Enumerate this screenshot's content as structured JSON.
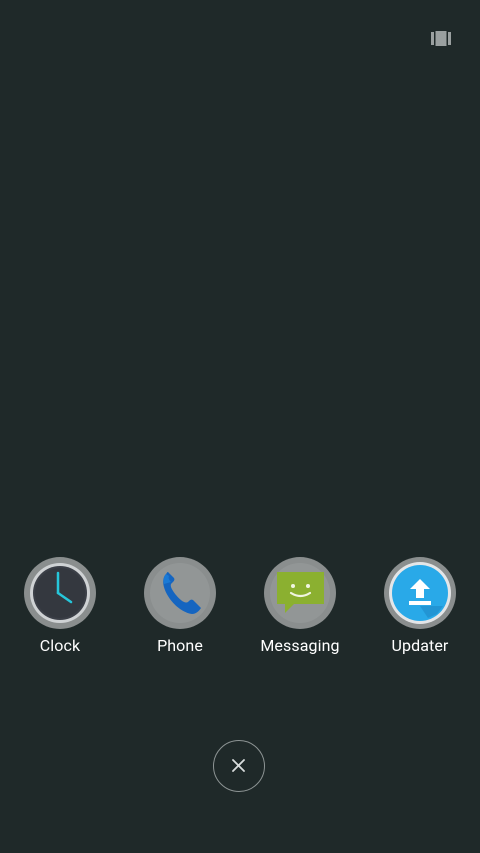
{
  "top_bar": {
    "icon": "recents-layout-icon"
  },
  "apps": [
    {
      "label": "Clock",
      "icon": "clock-icon"
    },
    {
      "label": "Phone",
      "icon": "phone-icon"
    },
    {
      "label": "Messaging",
      "icon": "messaging-icon"
    },
    {
      "label": "Updater",
      "icon": "updater-icon"
    }
  ],
  "dismiss": {
    "icon": "close-icon"
  },
  "colors": {
    "background": "#1f2929",
    "icon_ring": "#8e9191",
    "clock_face": "#3b3f47",
    "clock_hand": "#26c6da",
    "phone_blue": "#1565c0",
    "messaging_green": "#8bb030",
    "updater_blue": "#29a9e8"
  }
}
